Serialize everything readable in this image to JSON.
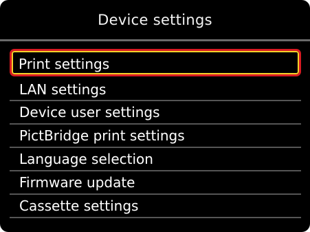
{
  "header": {
    "title": "Device settings"
  },
  "menu": {
    "items": [
      {
        "label": "Print settings"
      },
      {
        "label": "LAN settings"
      },
      {
        "label": "Device user settings"
      },
      {
        "label": "PictBridge print settings"
      },
      {
        "label": "Language selection"
      },
      {
        "label": "Firmware update"
      },
      {
        "label": "Cassette settings"
      }
    ]
  },
  "colors": {
    "background": "#000000",
    "text": "#ffffff",
    "selection_outer": "#d81b22",
    "selection_inner": "#f3d12a"
  }
}
